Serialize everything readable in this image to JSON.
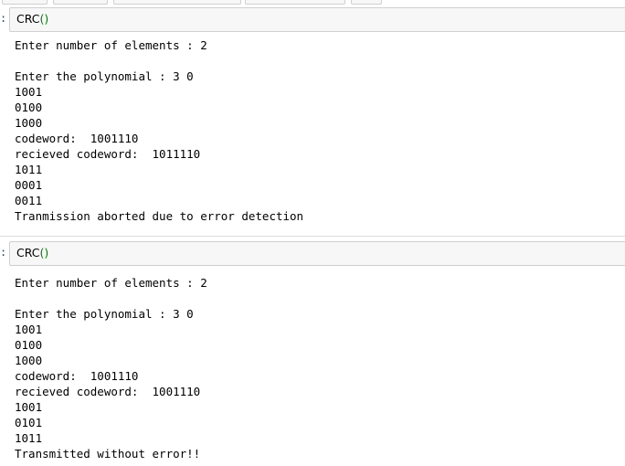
{
  "cells": [
    {
      "prompt": ":",
      "code_func": "CRC",
      "code_parens": "()",
      "output_lines": [
        "Enter number of elements : 2",
        "",
        "Enter the polynomial : 3 0",
        "1001",
        "0100",
        "1000",
        "codeword:  1001110",
        "recieved codeword:  1011110",
        "1011",
        "0001",
        "0011",
        "Tranmission aborted due to error detection"
      ]
    },
    {
      "prompt": ":",
      "code_func": "CRC",
      "code_parens": "()",
      "output_lines": [
        "Enter number of elements : 2",
        "",
        "Enter the polynomial : 3 0",
        "1001",
        "0100",
        "1000",
        "codeword:  1001110",
        "recieved codeword:  1001110",
        "1001",
        "0101",
        "1011",
        "Transmitted without error!!"
      ]
    }
  ]
}
